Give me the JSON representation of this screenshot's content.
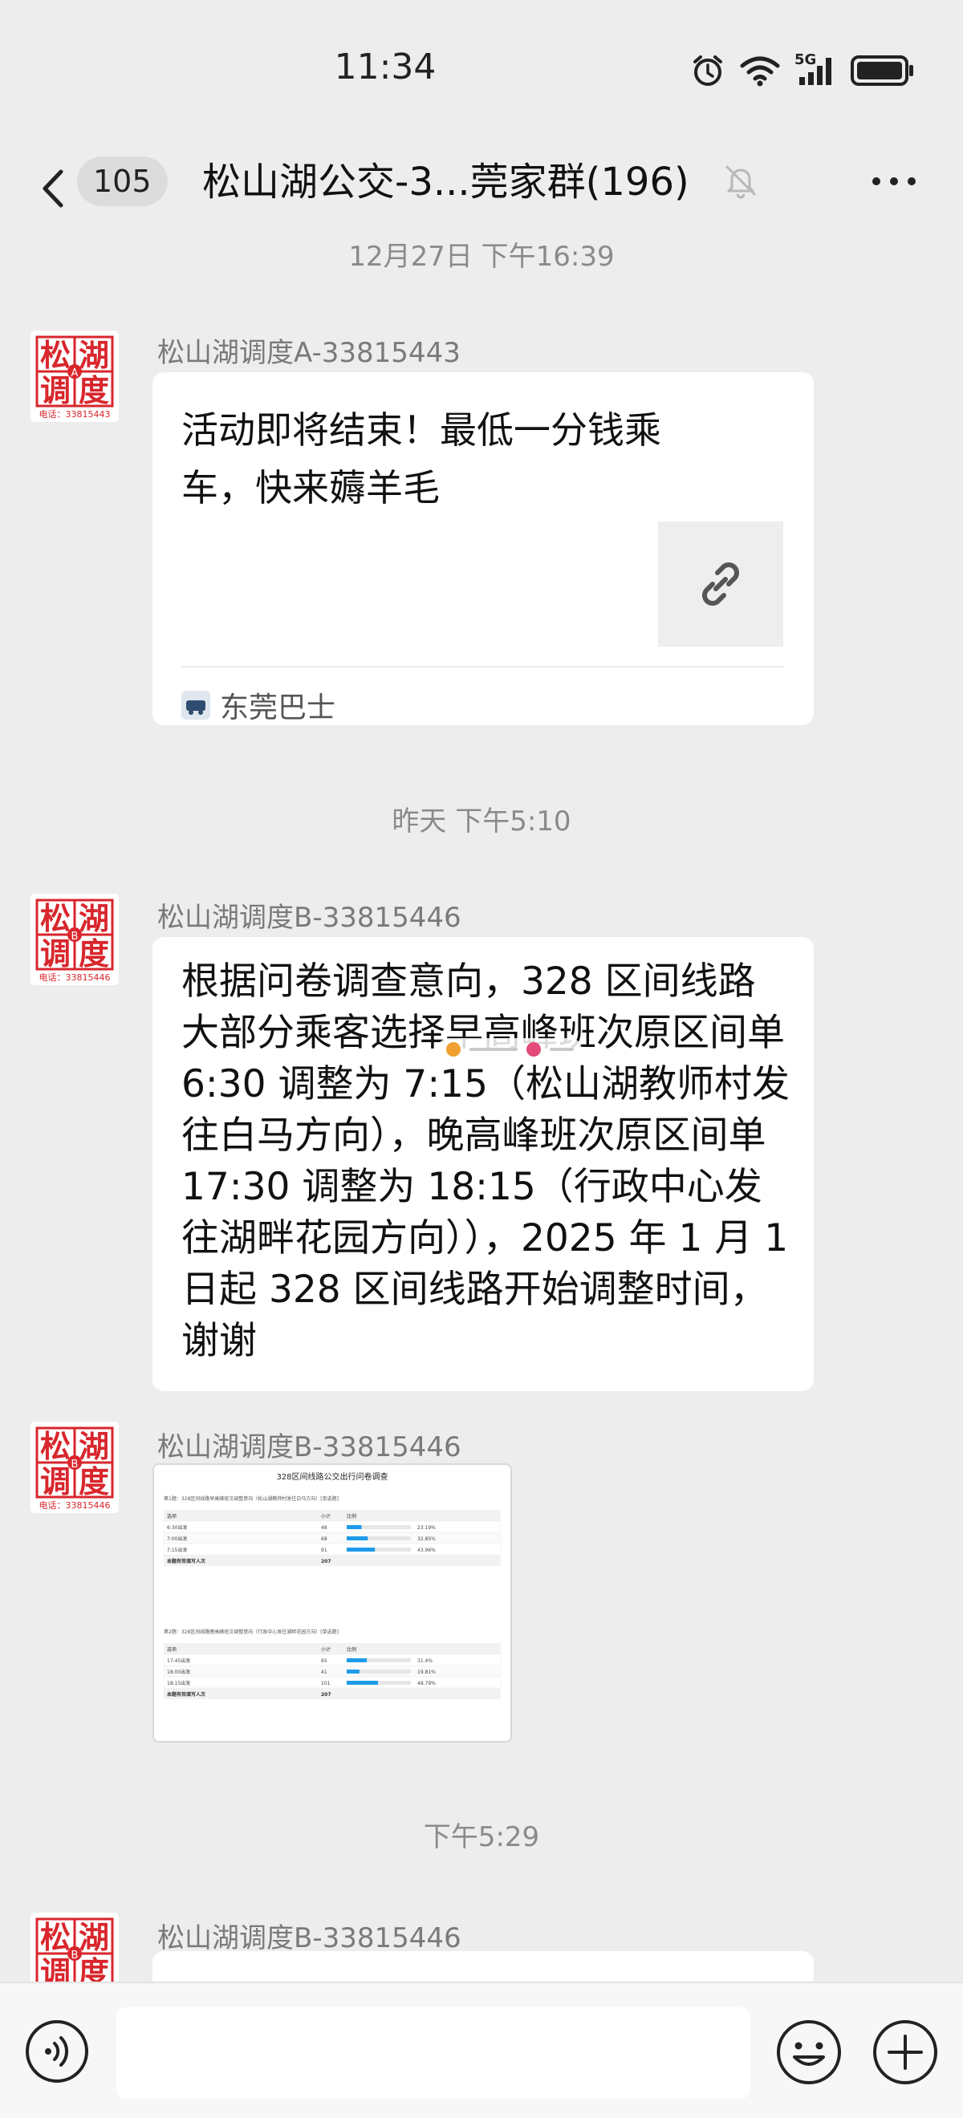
{
  "status_bar": {
    "time": "11:34",
    "network": "5G",
    "icons": [
      "alarm-icon",
      "wifi-icon",
      "signal-icon",
      "battery-icon"
    ]
  },
  "header": {
    "unread_count": "105",
    "title": "松山湖公交-3...莞家群(196)",
    "icons": [
      "back-arrow-icon",
      "mute-bell-icon",
      "more-dots-icon"
    ]
  },
  "timestamps": [
    "12月27日 下午16:39",
    "昨天 下午5:10",
    "下午5:29"
  ],
  "avatar": {
    "chars": [
      "松",
      "湖",
      "调",
      "度"
    ],
    "phones": [
      "电话：33815443",
      "电话：33815446"
    ],
    "letters": [
      "A",
      "B"
    ],
    "color": "#d8262c"
  },
  "messages": [
    {
      "sender": "松山湖调度A-33815443",
      "type": "link-card",
      "title": "活动即将结束！最低一分钱乘车，快来薅羊毛",
      "source": "东莞巴士"
    },
    {
      "sender": "松山湖调度B-33815446",
      "type": "text",
      "text": "根据问卷调查意向，328 区间线路大部分乘客选择早高峰班次原区间单 6:30 调整为 7:15（松山湖教师村发往白马方向），晚高峰班次原区间单 17:30 调整为 18:15（行政中心发往湖畔花园方向）），2025 年 1 月 1 日起 328 区间线路开始调整时间，谢谢"
    },
    {
      "sender": "松山湖调度B-33815446",
      "type": "image"
    },
    {
      "sender": "松山湖调度B-33815446",
      "type": "text",
      "text": ""
    }
  ],
  "survey_image": {
    "title": "328区间线路公交出行问卷调查",
    "q1": {
      "label": "第1题：328区间线路早高峰班次调整意向（松山湖教师村发往白马方向）[单选题]",
      "header": [
        "选项",
        "小计",
        "比例"
      ],
      "rows": [
        {
          "option": "6:30出发",
          "count": "48",
          "pct": "23.19%",
          "ratio": 0.2319
        },
        {
          "option": "7:00出发",
          "count": "68",
          "pct": "32.85%",
          "ratio": 0.3285
        },
        {
          "option": "7:15出发",
          "count": "91",
          "pct": "43.96%",
          "ratio": 0.4396
        }
      ],
      "total_label": "本题有效填写人次",
      "total": "207"
    },
    "q2": {
      "label": "第2题：328区间线路晚高峰班次调整意向（行政中心发往湖畔花园方向）[单选题]",
      "header": [
        "选项",
        "小计",
        "比例"
      ],
      "rows": [
        {
          "option": "17:45出发",
          "count": "65",
          "pct": "31.4%",
          "ratio": 0.314
        },
        {
          "option": "18:00出发",
          "count": "41",
          "pct": "19.81%",
          "ratio": 0.1981
        },
        {
          "option": "18:15出发",
          "count": "101",
          "pct": "48.79%",
          "ratio": 0.4879
        }
      ],
      "total_label": "本题有效填写人次",
      "total": "207"
    }
  },
  "input_bar": {
    "placeholder": "",
    "icons": [
      "voice-icon",
      "emoji-icon",
      "plus-icon"
    ]
  },
  "colors": {
    "background": "#ededed",
    "bubble": "#ffffff",
    "accent_bar": "#1e9be9",
    "avatar_red": "#d8262c"
  }
}
